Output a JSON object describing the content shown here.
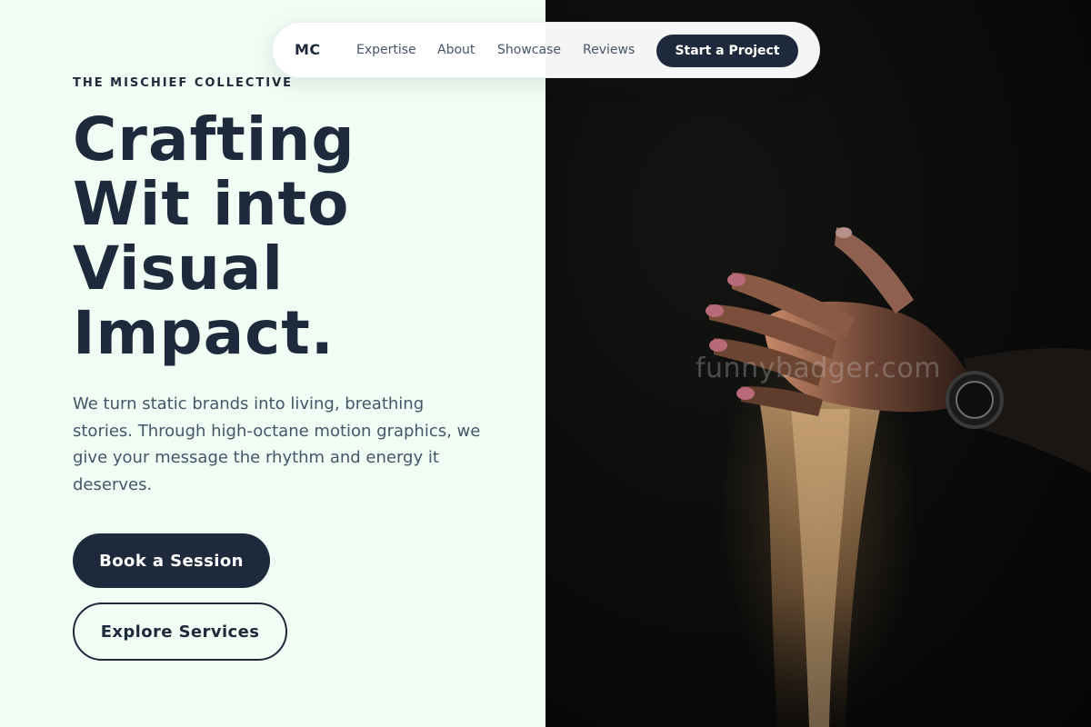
{
  "nav": {
    "logo": "MC",
    "links": [
      "Expertise",
      "About",
      "Showcase",
      "Reviews"
    ],
    "cta_label": "Start a Project"
  },
  "hero": {
    "eyebrow": "THE MISCHIEF COLLECTIVE",
    "headline_lines": [
      "Crafting",
      "Wit into",
      "Visual",
      "Impact."
    ],
    "lede": "We turn static brands into living, breathing stories. Through high-octane motion graphics, we give your message the rhythm and energy it deserves.",
    "primary_button": "Book a Session",
    "secondary_button": "Explore Services"
  },
  "image": {
    "watermark": "funnybadger.com",
    "subject": "hand releasing falling sand against dark background"
  },
  "colors": {
    "brand_dark": "#1e293b",
    "page_bg": "#f0fdf4",
    "text_muted": "#475569"
  }
}
